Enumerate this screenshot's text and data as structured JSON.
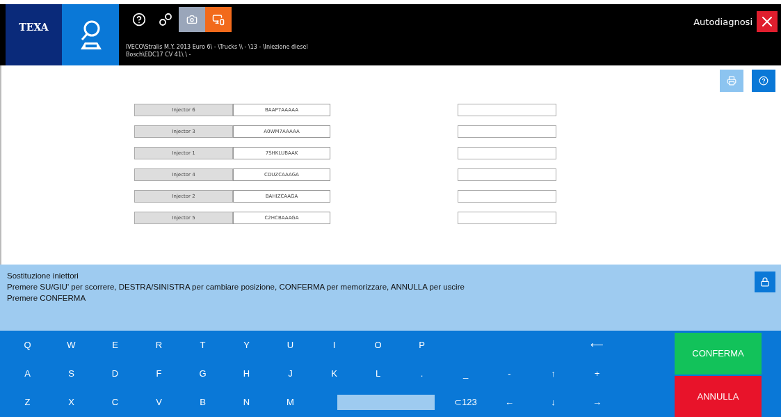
{
  "header": {
    "logo": "TEXA",
    "vehicle_lines": [
      "IVECO\\Stralis M.Y. 2013 Euro 6\\ - \\Trucks \\\\ - \\13 - \\Iniezione diesel",
      "Bosch\\EDC17 CV 41\\ \\ -"
    ],
    "title": "Autodiagnosi"
  },
  "injectors": [
    {
      "label": "Injector 6",
      "code": "BAAP7AAAAA"
    },
    {
      "label": "Injector 3",
      "code": "A0WM7AAAAA"
    },
    {
      "label": "Injector 1",
      "code": "7SHKLUBAAK"
    },
    {
      "label": "Injector 4",
      "code": "CDUZCAAAGA"
    },
    {
      "label": "Injector 2",
      "code": "BAHIZCAAGA"
    },
    {
      "label": "Injector 5",
      "code": "C2HCBAAAGA"
    }
  ],
  "info": {
    "title": "Sostituzione iniettori",
    "lines": [
      "Premere SU/GIU' per scorrere, DESTRA/SINISTRA per cambiare posizione, CONFERMA per memorizzare, ANNULLA per uscire",
      "Premere CONFERMA"
    ]
  },
  "keyboard": [
    [
      {
        "kind": "key",
        "label": "Q"
      },
      {
        "kind": "key",
        "label": "W"
      },
      {
        "kind": "key",
        "label": "E"
      },
      {
        "kind": "key",
        "label": "R"
      },
      {
        "kind": "key",
        "label": "T"
      },
      {
        "kind": "key",
        "label": "Y"
      },
      {
        "kind": "key",
        "label": "U"
      },
      {
        "kind": "key",
        "label": "I"
      },
      {
        "kind": "key",
        "label": "O"
      },
      {
        "kind": "key",
        "label": "P"
      },
      {
        "kind": "backspace",
        "label": "⟵"
      }
    ],
    [
      {
        "kind": "key",
        "label": "A"
      },
      {
        "kind": "key",
        "label": "S"
      },
      {
        "kind": "key",
        "label": "D"
      },
      {
        "kind": "key",
        "label": "F"
      },
      {
        "kind": "key",
        "label": "G"
      },
      {
        "kind": "key",
        "label": "H"
      },
      {
        "kind": "key",
        "label": "J"
      },
      {
        "kind": "key",
        "label": "K"
      },
      {
        "kind": "key",
        "label": "L"
      },
      {
        "kind": "key",
        "label": "."
      },
      {
        "kind": "key",
        "label": "_"
      },
      {
        "kind": "key",
        "label": "-"
      },
      {
        "kind": "key",
        "label": "↑"
      },
      {
        "kind": "key",
        "label": "+"
      }
    ],
    [
      {
        "kind": "key",
        "label": "Z"
      },
      {
        "kind": "key",
        "label": "X"
      },
      {
        "kind": "key",
        "label": "C"
      },
      {
        "kind": "key",
        "label": "V"
      },
      {
        "kind": "key",
        "label": "B"
      },
      {
        "kind": "key",
        "label": "N"
      },
      {
        "kind": "key",
        "label": "M"
      },
      {
        "kind": "space"
      },
      {
        "kind": "key",
        "label": "⊂123"
      },
      {
        "kind": "key",
        "label": "←"
      },
      {
        "kind": "key",
        "label": "↓"
      },
      {
        "kind": "key",
        "label": "→"
      }
    ]
  ],
  "actions": [
    {
      "kind": "confirm",
      "label": "CONFERMA"
    },
    {
      "kind": "cancel",
      "label": "ANNULLA"
    }
  ]
}
